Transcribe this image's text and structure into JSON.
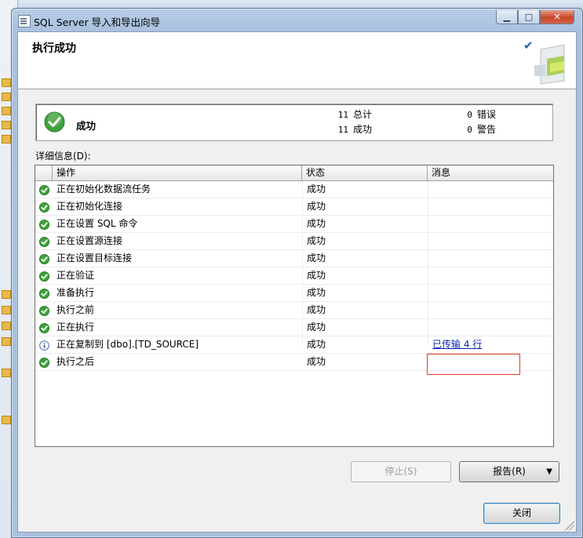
{
  "window": {
    "title": "SQL Server 导入和导出向导",
    "controls": {
      "minimize": "▁",
      "maximize": "□",
      "close": "✕"
    }
  },
  "header": {
    "title": "执行成功"
  },
  "summary": {
    "status": "成功",
    "total_count": "11",
    "total_label": "总计",
    "success_count": "11",
    "success_label": "成功",
    "error_count": "0",
    "error_label": "错误",
    "warning_count": "0",
    "warning_label": "警告"
  },
  "details": {
    "label": "详细信息(D):",
    "columns": [
      "操作",
      "状态",
      "消息"
    ],
    "rows": [
      {
        "icon": "success-icon",
        "operation": "正在初始化数据流任务",
        "status": "成功",
        "message": ""
      },
      {
        "icon": "success-icon",
        "operation": "正在初始化连接",
        "status": "成功",
        "message": ""
      },
      {
        "icon": "success-icon",
        "operation": "正在设置 SQL 命令",
        "status": "成功",
        "message": ""
      },
      {
        "icon": "success-icon",
        "operation": "正在设置源连接",
        "status": "成功",
        "message": ""
      },
      {
        "icon": "success-icon",
        "operation": "正在设置目标连接",
        "status": "成功",
        "message": ""
      },
      {
        "icon": "success-icon",
        "operation": "正在验证",
        "status": "成功",
        "message": ""
      },
      {
        "icon": "success-icon",
        "operation": "准备执行",
        "status": "成功",
        "message": ""
      },
      {
        "icon": "success-icon",
        "operation": "执行之前",
        "status": "成功",
        "message": ""
      },
      {
        "icon": "success-icon",
        "operation": "正在执行",
        "status": "成功",
        "message": ""
      },
      {
        "icon": "info-icon",
        "operation": "正在复制到 [dbo].[TD_SOURCE]",
        "status": "成功",
        "message": "已传输 4 行"
      },
      {
        "icon": "success-icon",
        "operation": "执行之后",
        "status": "成功",
        "message": ""
      }
    ]
  },
  "buttons": {
    "stop": "停止(S)",
    "report": "报告(R)",
    "close": "关闭"
  },
  "colors": {
    "success_green": "#3da33a",
    "link_blue": "#0a28b4",
    "highlight_red": "#e03a2a"
  }
}
